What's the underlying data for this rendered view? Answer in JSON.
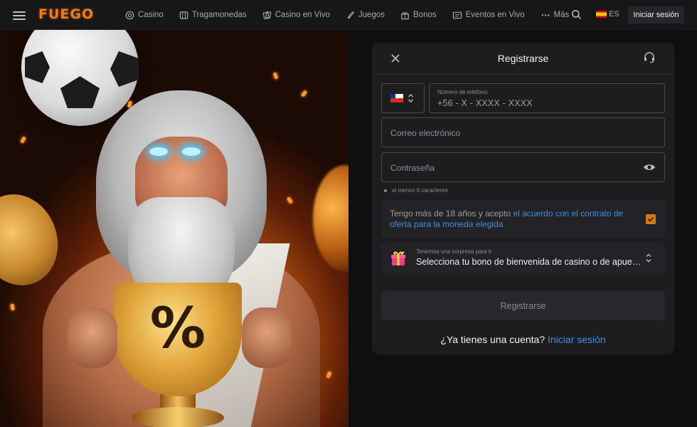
{
  "header": {
    "logo_text": "FUEGO",
    "nav": [
      {
        "label": "Casino",
        "icon": "casino-chip-icon"
      },
      {
        "label": "Tragamonedas",
        "icon": "slot-machine-icon"
      },
      {
        "label": "Casino en Vivo",
        "icon": "live-cards-icon"
      },
      {
        "label": "Juegos",
        "icon": "rocket-icon"
      },
      {
        "label": "Bonos",
        "icon": "gift-icon"
      },
      {
        "label": "Eventos en Vivo",
        "icon": "tv-icon"
      },
      {
        "label": "Más",
        "icon": "more-dots-icon"
      }
    ],
    "language": "ES",
    "login_label": "Iniciar sesión"
  },
  "form": {
    "title": "Registrarse",
    "phone_label": "Número de teléfono",
    "phone_placeholder": "+56 - X - XXXX - XXXX",
    "email_placeholder": "Correo electrónico",
    "password_placeholder": "Contraseña",
    "password_hint": "al menos 6 caracteres",
    "terms_prefix": "Tengo más de 18 años y acepto ",
    "terms_link": "el acuerdo con el contrato de oferta para la moneda elegida",
    "terms_checked": true,
    "bonus_label": "Tenemos una sorpresa para ti",
    "bonus_value": "Selecciona tu bono de bienvenida de casino o de apuesta deportiva",
    "submit_label": "Registrarse",
    "account_question": "¿Ya tienes una cuenta?",
    "account_login": "Iniciar sesión"
  },
  "colors": {
    "accent": "#d87914",
    "link": "#3f8fe0",
    "panel": "#1d1d20",
    "background": "#0f0f11"
  }
}
